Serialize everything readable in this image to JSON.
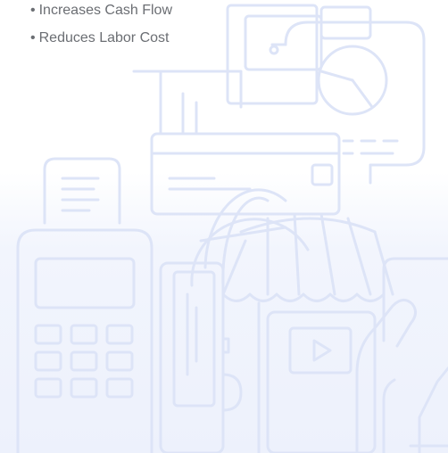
{
  "benefits": {
    "bullet": "•",
    "items": [
      {
        "label": "Increases Cash Flow"
      },
      {
        "label": "Reduces Labor Cost"
      }
    ]
  },
  "illustration": {
    "stroke_color": "#dde4f7",
    "icons": [
      "receipt-icon",
      "pie-chart-icon",
      "credit-card-icon",
      "card-terminal-icon",
      "globe-icon",
      "storefront-icon",
      "mobile-card-reader-icon",
      "tablet-icon",
      "hand-holding-phone-icon",
      "video-play-icon"
    ]
  }
}
